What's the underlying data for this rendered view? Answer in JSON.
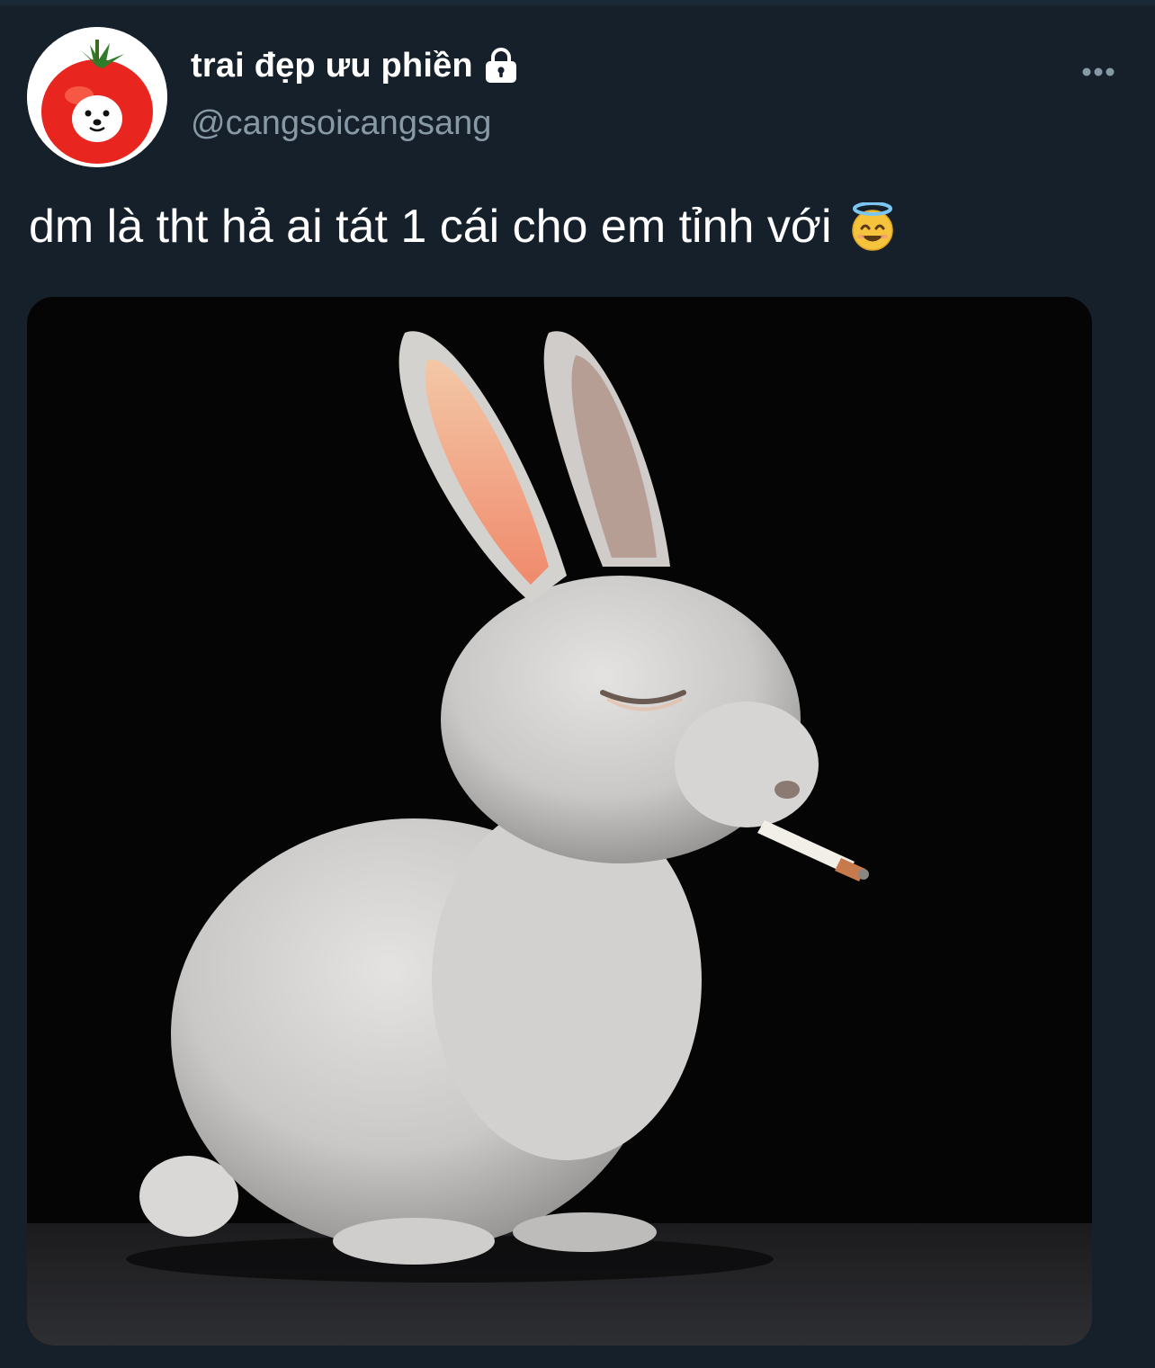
{
  "tweet": {
    "author": {
      "display_name": "trai đẹp ưu phiền",
      "handle": "@cangsoicangsang",
      "avatar_icon": "tomato-dog-avatar",
      "protected_icon": "lock-icon"
    },
    "text": "dm là tht hả ai tát 1 cái cho em tỉnh với",
    "emoji": "smiling-face-with-halo",
    "more_icon": "more-options-icon",
    "media": {
      "kind": "photo",
      "subject": "white-rabbit-smoking-icon"
    }
  },
  "colors": {
    "background": "#15202b",
    "name": "#ffffff",
    "handle": "#8899a6",
    "text": "#ffffff"
  }
}
